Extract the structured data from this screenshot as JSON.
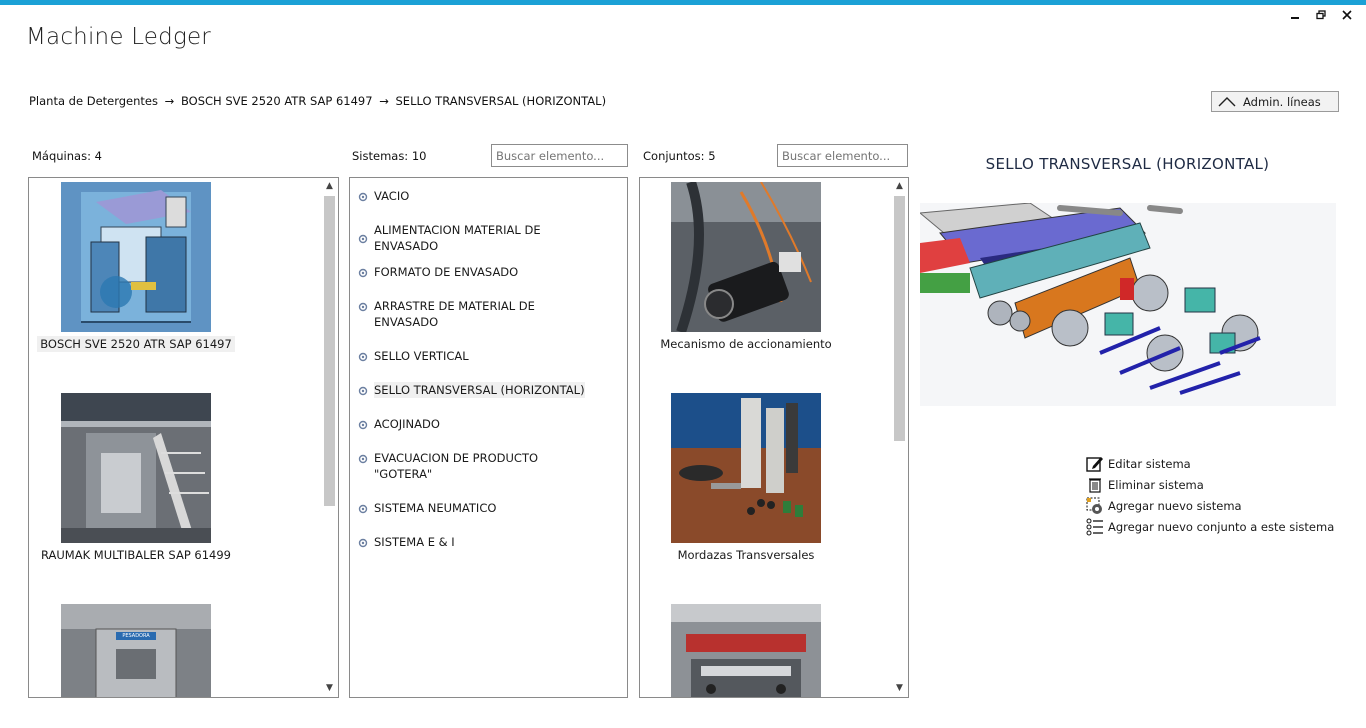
{
  "app": {
    "title": "Machine Ledger",
    "accent": "#1ba1d6",
    "window_controls": [
      "minimize-icon",
      "restore-icon",
      "close-icon"
    ]
  },
  "breadcrumb": {
    "items": [
      "Planta de Detergentes",
      "BOSCH SVE 2520 ATR  SAP 61497",
      "SELLO TRANSVERSAL (HORIZONTAL)"
    ],
    "separator": "→"
  },
  "admin_button": {
    "label": "Admin. líneas",
    "icon": "chevron-up-icon"
  },
  "machines": {
    "label": "Máquinas: 4",
    "items": [
      {
        "caption": "BOSCH SVE 2520 ATR  SAP 61497",
        "selected": true
      },
      {
        "caption": "RAUMAK MULTIBALER SAP 61499",
        "selected": false
      },
      {
        "caption": "",
        "selected": false,
        "sign": "PESADORA"
      }
    ]
  },
  "systems": {
    "label": "Sistemas: 10",
    "search_placeholder": "Buscar elemento...",
    "items": [
      {
        "label": "VACIO",
        "selected": false
      },
      {
        "label": "ALIMENTACION MATERIAL DE ENVASADO",
        "selected": false
      },
      {
        "label": "FORMATO DE ENVASADO",
        "selected": false
      },
      {
        "label": "ARRASTRE DE MATERIAL DE ENVASADO",
        "selected": false
      },
      {
        "label": "SELLO VERTICAL",
        "selected": false
      },
      {
        "label": "SELLO TRANSVERSAL (HORIZONTAL)",
        "selected": true
      },
      {
        "label": "ACOJINADO",
        "selected": false
      },
      {
        "label": "EVACUACION DE PRODUCTO \"GOTERA\"",
        "selected": false
      },
      {
        "label": "SISTEMA NEUMATICO",
        "selected": false
      },
      {
        "label": "SISTEMA E & I",
        "selected": false
      }
    ]
  },
  "assemblies": {
    "label": "Conjuntos: 5",
    "search_placeholder": "Buscar elemento...",
    "items": [
      {
        "caption": "Mecanismo de accionamiento"
      },
      {
        "caption": "Mordazas Transversales"
      },
      {
        "caption": ""
      }
    ]
  },
  "detail": {
    "title": "SELLO TRANSVERSAL (HORIZONTAL)",
    "actions": [
      {
        "label": "Editar sistema",
        "icon": "edit-icon"
      },
      {
        "label": "Eliminar sistema",
        "icon": "trash-icon"
      },
      {
        "label": "Agregar nuevo sistema",
        "icon": "add-system-icon"
      },
      {
        "label": "Agregar nuevo conjunto a este sistema",
        "icon": "add-list-icon"
      }
    ]
  }
}
